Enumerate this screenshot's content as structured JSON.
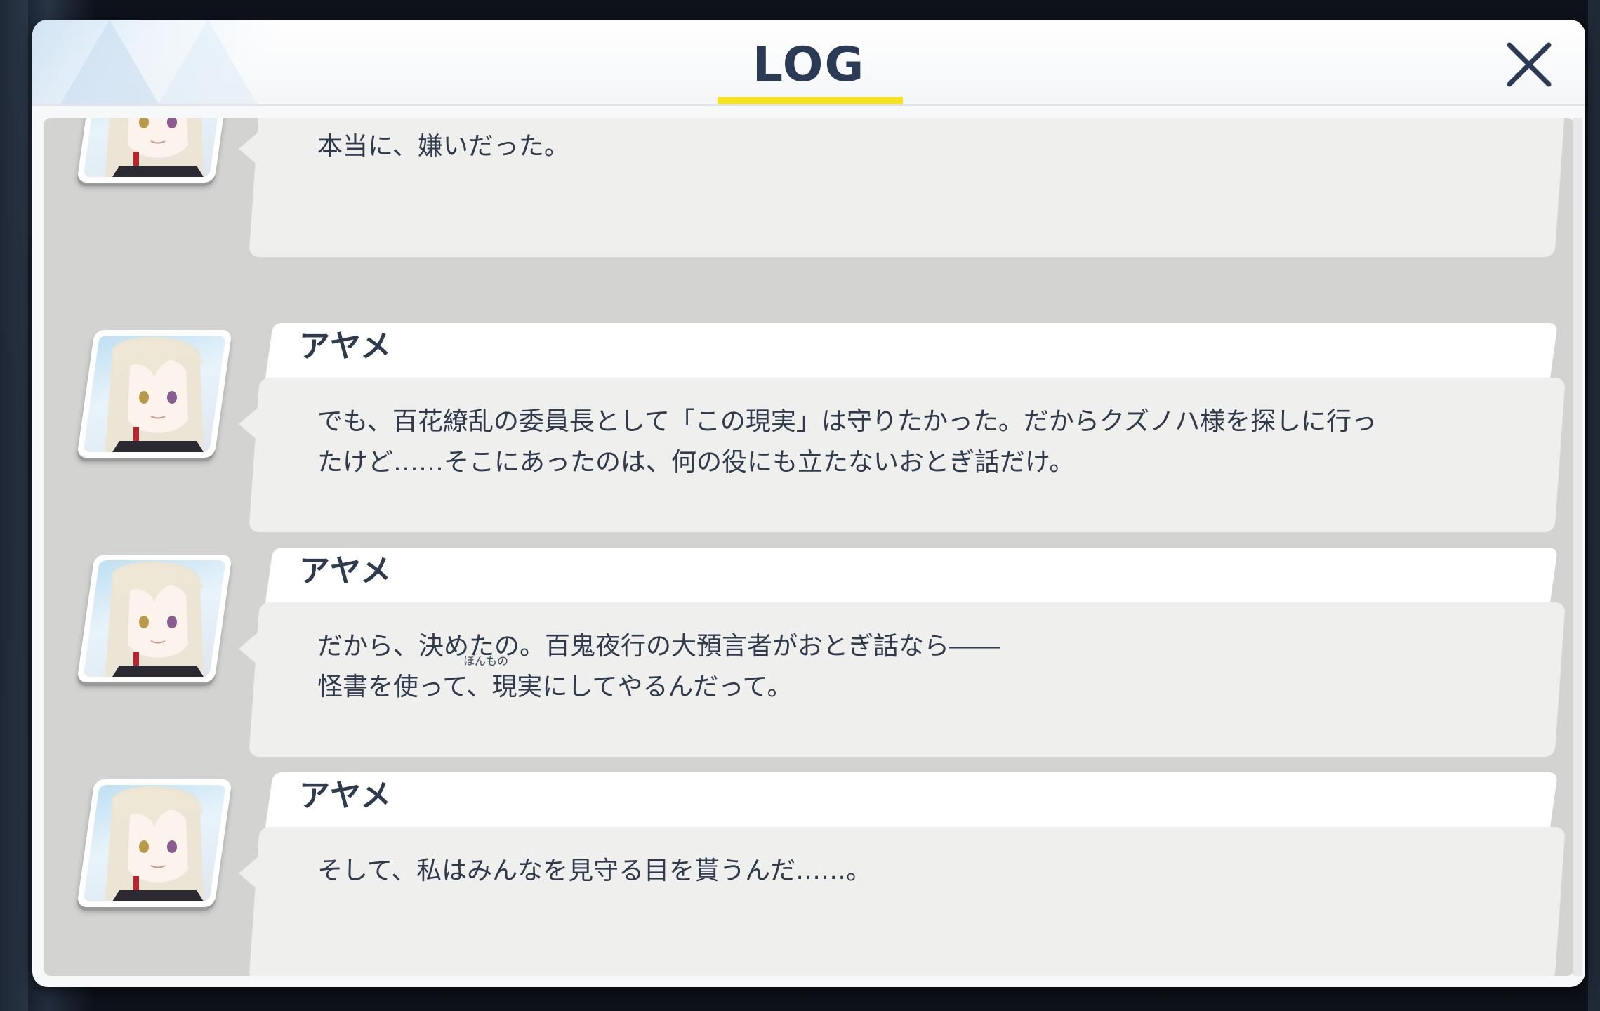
{
  "header": {
    "title": "LOG",
    "close_icon": "close-icon"
  },
  "colors": {
    "title_underline": "#f6e21c",
    "title_text": "#2b3a55",
    "panel_bg": "#f7f8f9",
    "content_bg": "#d3d3d2",
    "bubble_bg": "#efefee"
  },
  "log": {
    "entries": [
      {
        "speaker": "",
        "text": "本当に、嫌いだった。"
      },
      {
        "speaker": "アヤメ",
        "text": "でも、百花繚乱の委員長として「この現実」は守りたかった。だからクズノハ様を探しに行っ\nたけど……そこにあったのは、何の役にも立たないおとぎ話だけ。"
      },
      {
        "speaker": "アヤメ",
        "text": "だから、決めたの。百鬼夜行の大預言者がおとぎ話なら――\n怪書を使って、現実にしてやるんだって。",
        "ruby": "ほんもの"
      },
      {
        "speaker": "アヤメ",
        "text": "そして、私はみんなを見守る目を貰うんだ……。"
      }
    ]
  }
}
